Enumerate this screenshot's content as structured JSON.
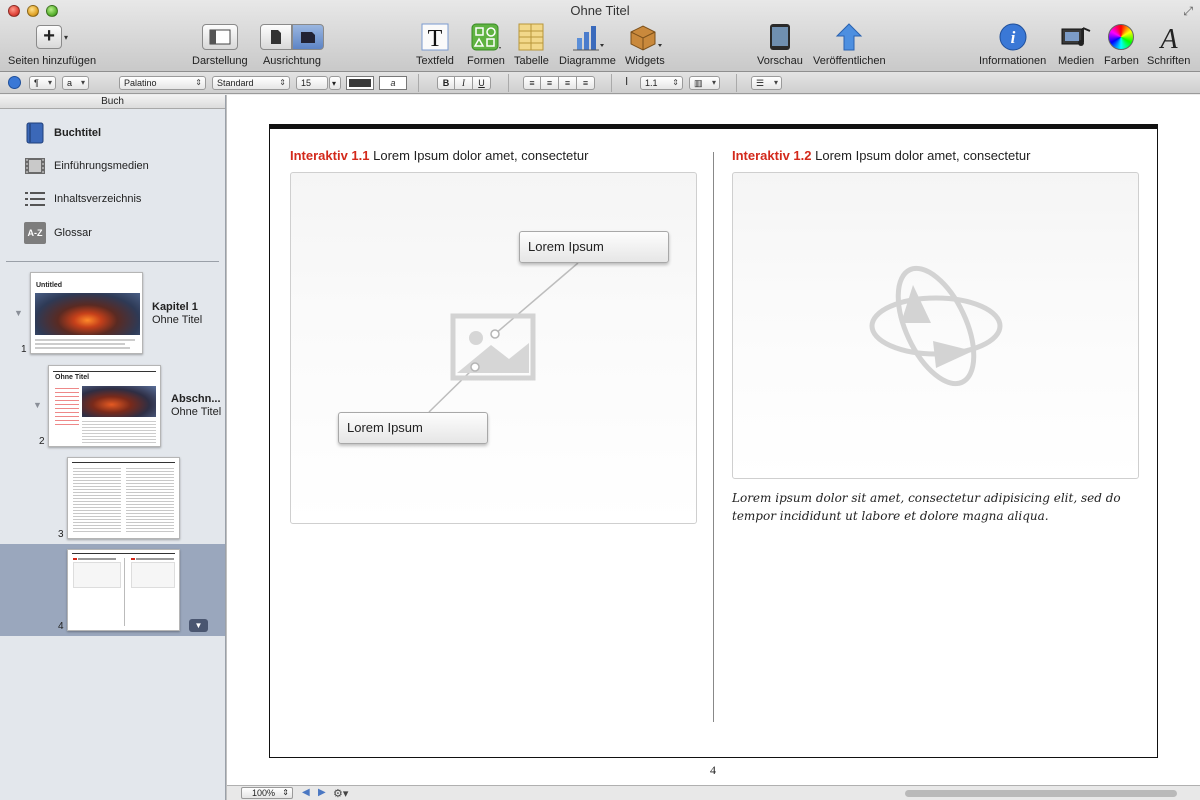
{
  "window": {
    "title": "Ohne Titel"
  },
  "toolbar": {
    "add_pages": "Seiten hinzufügen",
    "view": "Darstellung",
    "orientation": "Ausrichtung",
    "textbox": "Textfeld",
    "shapes": "Formen",
    "table": "Tabelle",
    "charts": "Diagramme",
    "widgets": "Widgets",
    "preview": "Vorschau",
    "publish": "Veröffentlichen",
    "info": "Informationen",
    "media": "Medien",
    "colors": "Farben",
    "fonts": "Schriften"
  },
  "formatbar": {
    "paragraph_style": "¶",
    "char_style": "a",
    "font": "Palatino",
    "typeface": "Standard",
    "size": "15",
    "bold": "B",
    "italic": "I",
    "underline": "U",
    "line_spacing": "1.1",
    "text_color": "#3a3a3a"
  },
  "sidebar": {
    "header": "Buch",
    "items": [
      {
        "label": "Buchtitel",
        "icon": "book-icon"
      },
      {
        "label": "Einführungsmedien",
        "icon": "film-icon"
      },
      {
        "label": "Inhaltsverzeichnis",
        "icon": "list-icon"
      },
      {
        "label": "Glossar",
        "icon": "az-icon",
        "icon_text": "A-Z"
      }
    ],
    "chapters": [
      {
        "title": "Kapitel 1",
        "subtitle": "Ohne Titel",
        "page": "1",
        "thumb_title": "Untitled"
      },
      {
        "title": "Abschn...",
        "subtitle": "Ohne Titel",
        "page": "2",
        "thumb_title": "Ohne Titel"
      }
    ],
    "pages": [
      {
        "page": "3"
      },
      {
        "page": "4"
      }
    ]
  },
  "canvas": {
    "widget1": {
      "label": "Interaktiv 1.1",
      "caption": "Lorem Ipsum dolor amet, consectetur",
      "callout1": "Lorem Ipsum",
      "callout2": "Lorem Ipsum"
    },
    "widget2": {
      "label": "Interaktiv 1.2",
      "caption": "Lorem Ipsum dolor amet, consectetur"
    },
    "description": "Lorem ipsum dolor sit amet, consectetur adipisicing elit, sed do tempor incididunt ut labore et dolore magna aliqua.",
    "page_number": "4"
  },
  "bottombar": {
    "zoom": "100%"
  },
  "colors": {
    "accent_red": "#d3291b",
    "selection": "#9aa7bd"
  }
}
